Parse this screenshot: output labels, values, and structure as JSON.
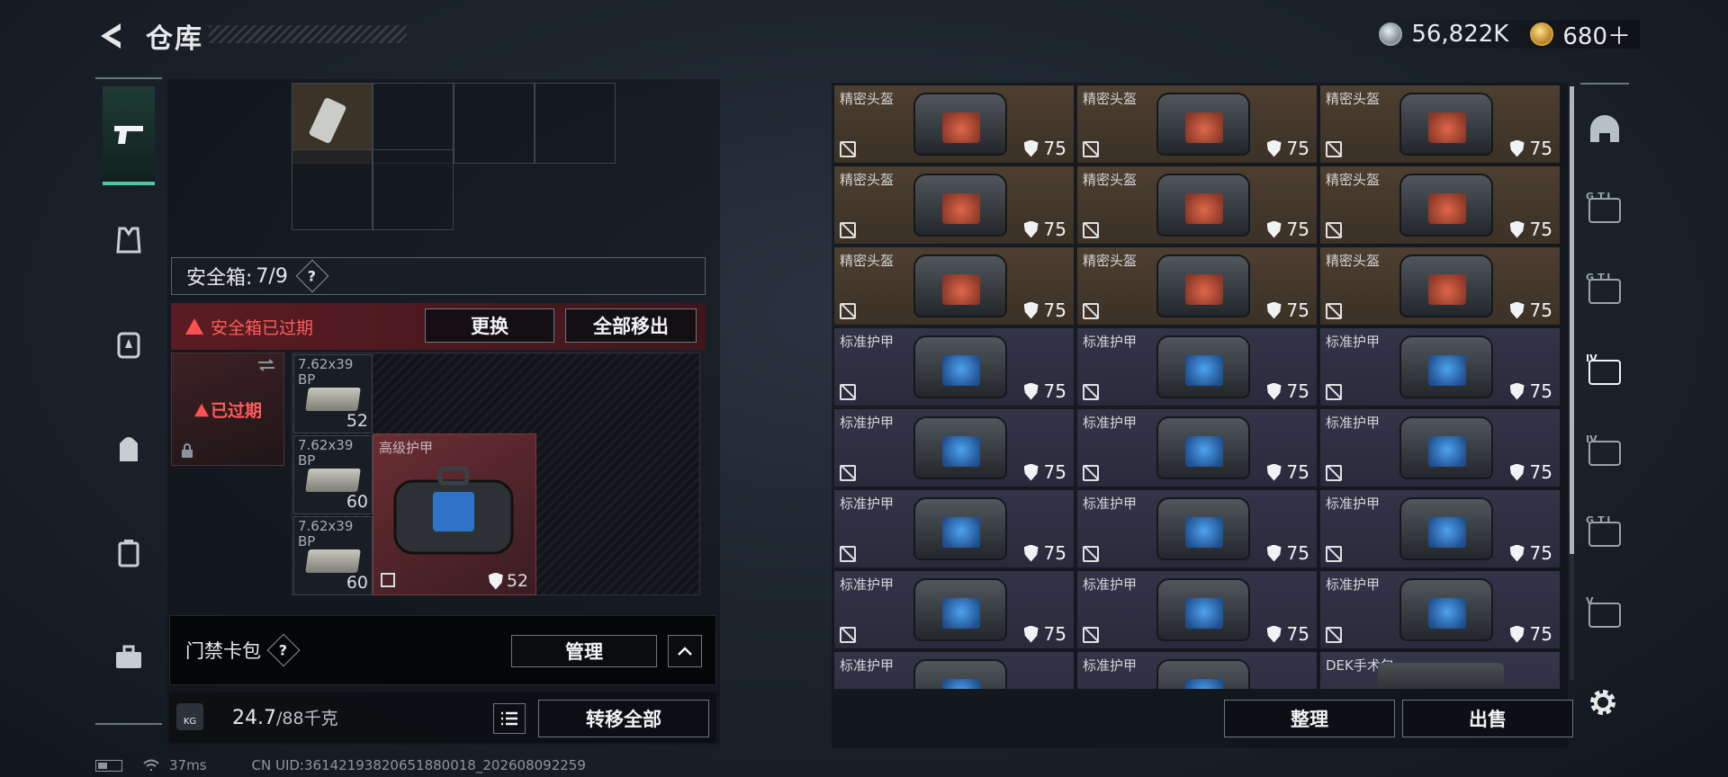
{
  "header": {
    "title": "仓库",
    "silver": "56,822K",
    "gold": "680＋"
  },
  "left": {
    "safebox_label": "安全箱:",
    "safebox_value": "7/9",
    "help": "?",
    "expired_msg": "安全箱已过期",
    "replace_label": "更换",
    "remove_all_label": "全部移出",
    "case_status": "已过期",
    "ammo": [
      {
        "name": "7.62x39",
        "sub": "BP",
        "count": "52"
      },
      {
        "name": "7.62x39",
        "sub": "BP",
        "count": "60"
      },
      {
        "name": "7.62x39",
        "sub": "BP",
        "count": "60"
      }
    ],
    "armor": {
      "name": "高级护甲",
      "durability": "52"
    },
    "card_label": "门禁卡包",
    "manage_label": "管理",
    "weight_value": "24.7",
    "weight_max": "/88千克",
    "kg": "KG",
    "transfer_label": "转移全部"
  },
  "storage": {
    "items": [
      {
        "name": "精密头盔",
        "type": "helmet",
        "durability": "75"
      },
      {
        "name": "精密头盔",
        "type": "helmet",
        "durability": "75"
      },
      {
        "name": "精密头盔",
        "type": "helmet",
        "durability": "75"
      },
      {
        "name": "精密头盔",
        "type": "helmet",
        "durability": "75"
      },
      {
        "name": "精密头盔",
        "type": "helmet",
        "durability": "75"
      },
      {
        "name": "精密头盔",
        "type": "helmet",
        "durability": "75"
      },
      {
        "name": "精密头盔",
        "type": "helmet",
        "durability": "75"
      },
      {
        "name": "精密头盔",
        "type": "helmet",
        "durability": "75"
      },
      {
        "name": "精密头盔",
        "type": "helmet",
        "durability": "75"
      },
      {
        "name": "标准护甲",
        "type": "armor",
        "durability": "75"
      },
      {
        "name": "标准护甲",
        "type": "armor",
        "durability": "75"
      },
      {
        "name": "标准护甲",
        "type": "armor",
        "durability": "75"
      },
      {
        "name": "标准护甲",
        "type": "armor",
        "durability": "75"
      },
      {
        "name": "标准护甲",
        "type": "armor",
        "durability": "75"
      },
      {
        "name": "标准护甲",
        "type": "armor",
        "durability": "75"
      },
      {
        "name": "标准护甲",
        "type": "armor",
        "durability": "75"
      },
      {
        "name": "标准护甲",
        "type": "armor",
        "durability": "75"
      },
      {
        "name": "标准护甲",
        "type": "armor",
        "durability": "75"
      },
      {
        "name": "标准护甲",
        "type": "armor",
        "durability": "75"
      },
      {
        "name": "标准护甲",
        "type": "armor",
        "durability": "75"
      },
      {
        "name": "标准护甲",
        "type": "armor",
        "durability": "75"
      },
      {
        "name": "标准护甲",
        "type": "armor",
        "durability": ""
      },
      {
        "name": "标准护甲",
        "type": "armor",
        "durability": ""
      },
      {
        "name": "DEK手术包",
        "type": "dek",
        "durability": ""
      }
    ],
    "sort_label": "整理",
    "sell_label": "出售"
  },
  "filters": [
    "G.T.I",
    "G.T.I",
    "IV",
    "IV",
    "G.T.I",
    "V"
  ],
  "status": {
    "ping": "37ms",
    "uid": "CN UID:36142193820651880018_202608092259"
  }
}
